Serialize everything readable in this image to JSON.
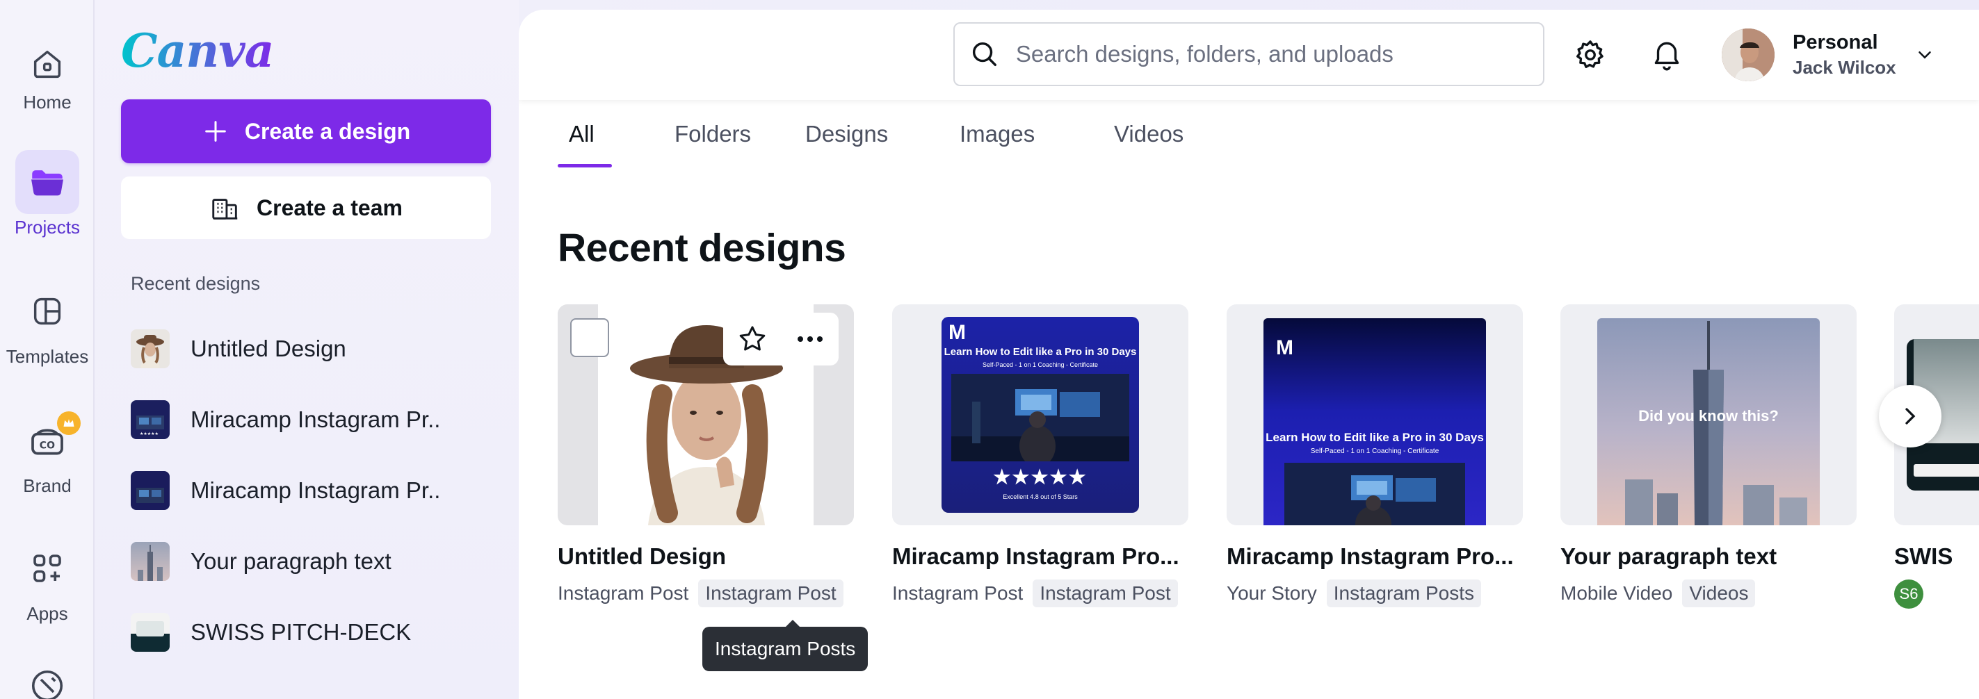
{
  "rail": {
    "items": [
      {
        "label": "Home",
        "icon": "home-icon"
      },
      {
        "label": "Projects",
        "icon": "folder-icon",
        "active": true
      },
      {
        "label": "Templates",
        "icon": "templates-icon"
      },
      {
        "label": "Brand",
        "icon": "brand-icon"
      },
      {
        "label": "Apps",
        "icon": "apps-icon"
      }
    ]
  },
  "sidebar": {
    "logo": "Canva",
    "create_design_label": "Create a design",
    "create_team_label": "Create a team",
    "recent_heading": "Recent designs",
    "recent_items": [
      {
        "label": "Untitled Design"
      },
      {
        "label": "Miracamp Instagram Pr.."
      },
      {
        "label": "Miracamp Instagram Pr.."
      },
      {
        "label": "Your paragraph text"
      },
      {
        "label": "SWISS PITCH-DECK"
      }
    ]
  },
  "topbar": {
    "search_placeholder": "Search designs, folders, and uploads",
    "account_name": "Personal",
    "account_user": "Jack Wilcox"
  },
  "tabs": [
    "All",
    "Folders",
    "Designs",
    "Images",
    "Videos"
  ],
  "section_title": "Recent designs",
  "cards": [
    {
      "title": "Untitled Design",
      "type": "Instagram Post",
      "folder": "Instagram Post"
    },
    {
      "title": "Miracamp Instagram Pro...",
      "type": "Instagram Post",
      "folder": "Instagram Post",
      "poster": {
        "logo": "M",
        "headline": "Learn How to Edit like a Pro in 30 Days",
        "sub": "Self-Paced - 1 on 1 Coaching - Certificate",
        "stars": "★★★★★",
        "rating": "Excellent 4.8 out of 5 Stars"
      }
    },
    {
      "title": "Miracamp Instagram Pro...",
      "type": "Your Story",
      "folder": "Instagram Posts",
      "poster": {
        "logo": "M",
        "headline": "Learn How to Edit like a Pro in 30 Days",
        "sub": "Self-Paced - 1 on 1 Coaching - Certificate"
      }
    },
    {
      "title": "Your paragraph text",
      "type": "Mobile Video",
      "folder": "Videos",
      "poster": {
        "headline": "Did you know this?"
      }
    },
    {
      "title": "SWIS",
      "avatar": "S6"
    }
  ],
  "tooltip": "Instagram Posts",
  "colors": {
    "accent": "#7d2ae8",
    "active_nav_bg": "#e3defb",
    "crown": "#f7b32b"
  }
}
